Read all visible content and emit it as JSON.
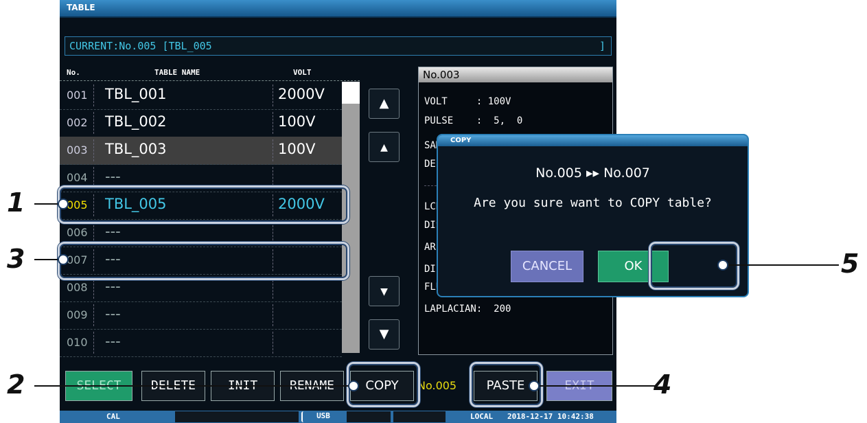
{
  "window": {
    "title": "TABLE"
  },
  "current": {
    "label": "CURRENT:No.005 [TBL_005",
    "bracket_close": "]"
  },
  "table": {
    "headers": {
      "no": "No.",
      "name": "TABLE NAME",
      "volt": "VOLT"
    },
    "rows": [
      {
        "no": "001",
        "name": "TBL_001",
        "volt": "2000V"
      },
      {
        "no": "002",
        "name": "TBL_002",
        "volt": "100V"
      },
      {
        "no": "003",
        "name": "TBL_003",
        "volt": "100V"
      },
      {
        "no": "004",
        "name": "---",
        "volt": ""
      },
      {
        "no": "005",
        "name": "TBL_005",
        "volt": "2000V"
      },
      {
        "no": "006",
        "name": "---",
        "volt": ""
      },
      {
        "no": "007",
        "name": "---",
        "volt": ""
      },
      {
        "no": "008",
        "name": "---",
        "volt": ""
      },
      {
        "no": "009",
        "name": "---",
        "volt": ""
      },
      {
        "no": "010",
        "name": "---",
        "volt": ""
      }
    ]
  },
  "icons": {
    "page_up": "double-up-arrow-icon",
    "line_up": "up-arrow-icon",
    "line_down": "down-arrow-icon",
    "page_down": "double-down-arrow-icon"
  },
  "info": {
    "title": "No.003",
    "volt": "VOLT     : 100V",
    "pulse": "PULSE    :  5,  0",
    "sampling": "SAMPLING :",
    "delay": "DELAY    :",
    "lcrc": "LCRC AREA:",
    "discharge": "DISCHARGE:",
    "area": "AREA     :",
    "diff_area": "DIFF AREA:",
    "flutter": "FLUTTER  :",
    "laplacian": "LAPLACIAN:  200"
  },
  "buttons": {
    "select": "SELECT",
    "delete": "DELETE",
    "init": "INIT",
    "rename": "RENAME",
    "copy": "COPY",
    "paste": "PASTE",
    "exit": "EXIT"
  },
  "clipboard": "No.005",
  "status": {
    "cal": "CAL",
    "usb": "USB",
    "local": "LOCAL",
    "datetime": "2018-12-17 10:42:38"
  },
  "dialog": {
    "title": "COPY",
    "line1": "No.005 ▸▸ No.007",
    "line2": "Are you sure want to COPY table?",
    "cancel": "CANCEL",
    "ok": "OK"
  },
  "callouts": [
    "1",
    "2",
    "3",
    "4",
    "5"
  ],
  "colors": {
    "accent": "#2b80b8",
    "ok_green": "#1f9b6a",
    "cancel_blue": "#6a72b9",
    "current_yellow": "#f3e000",
    "current_cyan": "#43c7e6"
  }
}
